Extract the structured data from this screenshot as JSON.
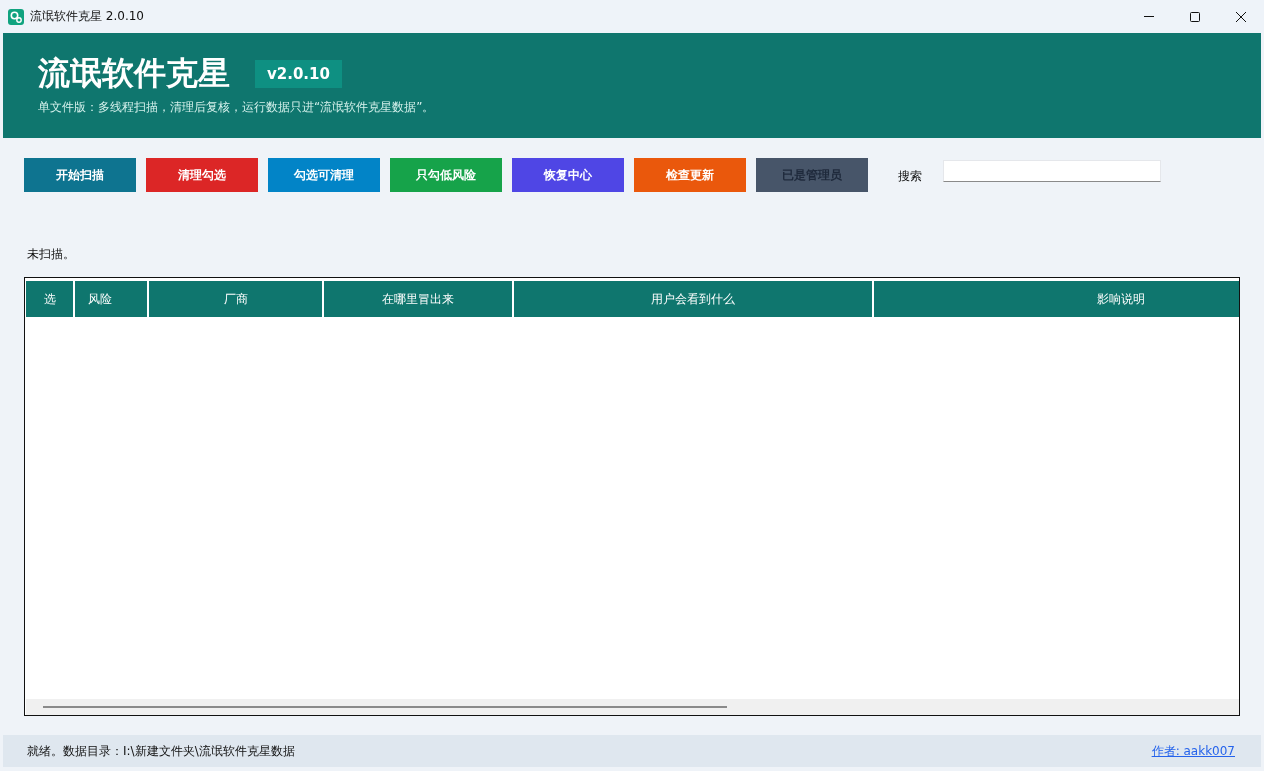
{
  "window": {
    "title": "流氓软件克星 2.0.10"
  },
  "header": {
    "title": "流氓软件克星",
    "version": "v2.0.10",
    "subtitle": "单文件版：多线程扫描，清理后复核，运行数据只进“流氓软件克星数据”。"
  },
  "toolbar": {
    "buttons": [
      {
        "label": "开始扫描",
        "color": "#0e7490",
        "disabled": false
      },
      {
        "label": "清理勾选",
        "color": "#dc2626",
        "disabled": false
      },
      {
        "label": "勾选可清理",
        "color": "#0284c7",
        "disabled": false
      },
      {
        "label": "只勾低风险",
        "color": "#16a34a",
        "disabled": false
      },
      {
        "label": "恢复中心",
        "color": "#4f46e5",
        "disabled": false
      },
      {
        "label": "检查更新",
        "color": "#ea580c",
        "disabled": false
      },
      {
        "label": "已是管理员",
        "color": "#475569",
        "disabled": true
      }
    ],
    "search": {
      "label": "搜索"
    }
  },
  "scan_status": "未扫描。",
  "table": {
    "columns": [
      "选",
      "风险",
      "厂商",
      "在哪里冒出来",
      "用户会看到什么",
      "影响说明"
    ]
  },
  "status_bar": {
    "text": "就绪。数据目录：I:\\新建文件夹\\流氓软件克星数据",
    "author_link": "作者: aakk007"
  }
}
